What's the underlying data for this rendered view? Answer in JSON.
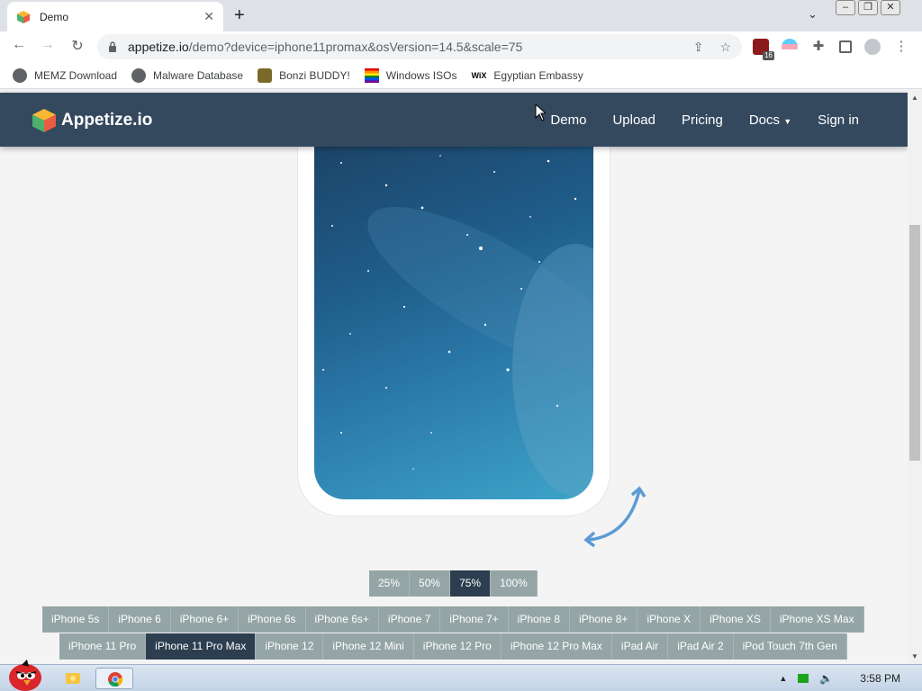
{
  "browser": {
    "tab_title": "Demo",
    "url_host": "appetize.io",
    "url_path": "/demo?device=iphone11promax&osVersion=14.5&scale=75",
    "extension_badge": "16",
    "bookmarks": [
      {
        "label": "MEMZ Download"
      },
      {
        "label": "Malware Database"
      },
      {
        "label": "Bonzi BUDDY!"
      },
      {
        "label": "Windows ISOs"
      },
      {
        "label": "Egyptian Embassy"
      }
    ]
  },
  "site": {
    "brand": "Appetize.io",
    "nav": [
      "Demo",
      "Upload",
      "Pricing",
      "Docs",
      "Sign in"
    ]
  },
  "scales": [
    "25%",
    "50%",
    "75%",
    "100%"
  ],
  "active_scale": "75%",
  "devices_row1": [
    "iPhone 5s",
    "iPhone 6",
    "iPhone 6+",
    "iPhone 6s",
    "iPhone 6s+",
    "iPhone 7",
    "iPhone 7+",
    "iPhone 8",
    "iPhone 8+",
    "iPhone X",
    "iPhone XS",
    "iPhone XS Max"
  ],
  "devices_row2": [
    "iPhone 11 Pro",
    "iPhone 11 Pro Max",
    "iPhone 12",
    "iPhone 12 Mini",
    "iPhone 12 Pro",
    "iPhone 12 Pro Max",
    "iPad Air",
    "iPad Air 2",
    "iPod Touch 7th Gen"
  ],
  "active_device": "iPhone 11 Pro Max",
  "taskbar": {
    "time": "3:58 PM"
  },
  "colors": {
    "navbar": "#34495e",
    "button": "#95a5a6",
    "active": "#2c3e50"
  }
}
